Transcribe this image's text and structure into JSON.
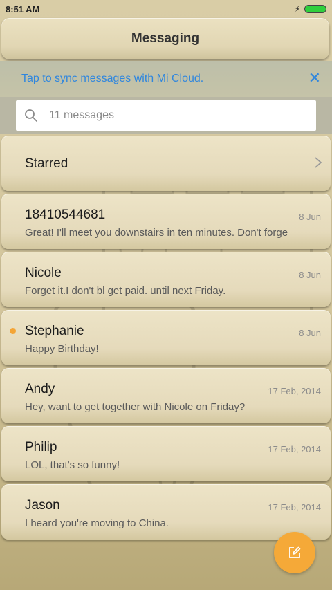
{
  "status_bar": {
    "time": "8:51 AM",
    "battery_color": "#30cf3d",
    "icons": [
      "bolt-icon",
      "battery-icon"
    ]
  },
  "header": {
    "title": "Messaging"
  },
  "sync_banner": {
    "text": "Tap to sync messages with Mi Cloud.",
    "accent_color": "#2f86de",
    "close_icon": "close-icon"
  },
  "search": {
    "placeholder": "11 messages",
    "icon": "search-icon"
  },
  "starred": {
    "label": "Starred",
    "icon": "chevron-right-icon"
  },
  "conversations": [
    {
      "name": "18410544681",
      "date": "8 Jun",
      "preview": "Great! I'll meet you downstairs in ten minutes. Don't forge",
      "unread": false
    },
    {
      "name": "Nicole",
      "date": "8 Jun",
      "preview": "Forget it.I don't bl get paid. until next Friday.",
      "unread": false
    },
    {
      "name": "Stephanie",
      "date": "8 Jun",
      "preview": "Happy Birthday!",
      "unread": true
    },
    {
      "name": "Andy",
      "date": "17 Feb, 2014",
      "preview": "Hey, want to get together with Nicole on Friday?",
      "unread": false
    },
    {
      "name": "Philip",
      "date": "17 Feb, 2014",
      "preview": "LOL, that's so funny!",
      "unread": false
    },
    {
      "name": "Jason",
      "date": "17 Feb, 2014",
      "preview": "I heard you're moving to China.",
      "unread": false
    }
  ],
  "compose": {
    "icon": "compose-icon",
    "color": "#f5a938"
  },
  "colors": {
    "unread_dot": "#f4a536"
  }
}
